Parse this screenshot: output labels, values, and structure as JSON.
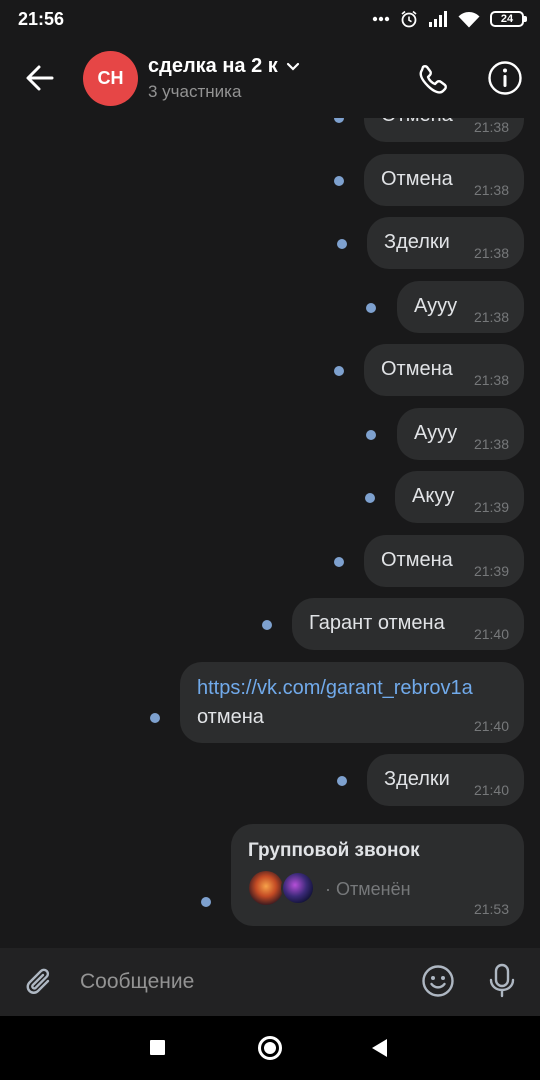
{
  "status_bar": {
    "time": "21:56",
    "battery": "24"
  },
  "header": {
    "avatar_initials": "СН",
    "title": "сделка на 2 к",
    "subtitle": "3 участника"
  },
  "messages": [
    {
      "text": "Отмена",
      "time": "21:38"
    },
    {
      "text": "Отмена",
      "time": "21:38"
    },
    {
      "text": "Зделки",
      "time": "21:38"
    },
    {
      "text": "Аууу",
      "time": "21:38"
    },
    {
      "text": "Отмена",
      "time": "21:38"
    },
    {
      "text": "Аууу",
      "time": "21:38"
    },
    {
      "text": "Акуу",
      "time": "21:39"
    },
    {
      "text": "Отмена",
      "time": "21:39"
    },
    {
      "text": "Гарант отмена",
      "time": "21:40"
    },
    {
      "link": "https://vk.com/garant_rebrov1a",
      "text": "отмена",
      "time": "21:40"
    },
    {
      "text": "Зделки",
      "time": "21:40"
    }
  ],
  "call_message": {
    "title": "Групповой звонок",
    "status": "· Отменён",
    "time": "21:53"
  },
  "composer": {
    "placeholder": "Сообщение"
  }
}
